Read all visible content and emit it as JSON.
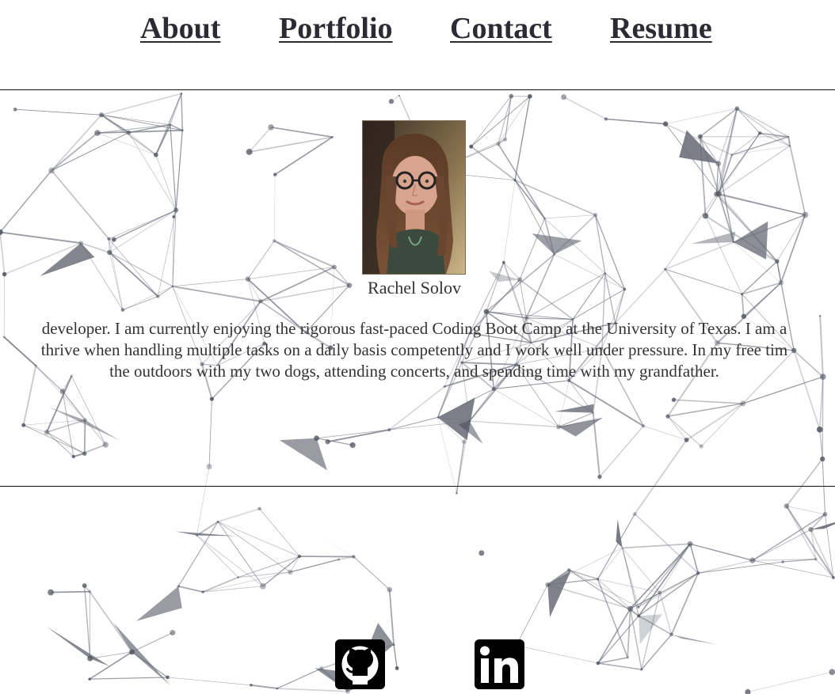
{
  "nav": {
    "items": [
      {
        "label": "About"
      },
      {
        "label": "Portfolio"
      },
      {
        "label": "Contact"
      },
      {
        "label": "Resume"
      }
    ]
  },
  "profile": {
    "photo_alt": "Rachel Solov",
    "name": "Rachel Solov",
    "bio_lines": [
      "developer. I am currently enjoying the rigorous fast-paced Coding Boot Camp at the University of Texas. I am a",
      "thrive when handling multiple tasks on a daily basis competently and I work well under pressure. In my free tim",
      "the outdoors with my two dogs, attending concerts, and spending time with my grandfather."
    ]
  },
  "social": {
    "github_icon": "github-icon",
    "linkedin_icon": "linkedin-icon",
    "linkedin_text": "in"
  },
  "colors": {
    "nav_text": "#2b2b33",
    "body_text": "#333333",
    "network_line": "#4a4e5c",
    "icon_bg": "#000000"
  }
}
